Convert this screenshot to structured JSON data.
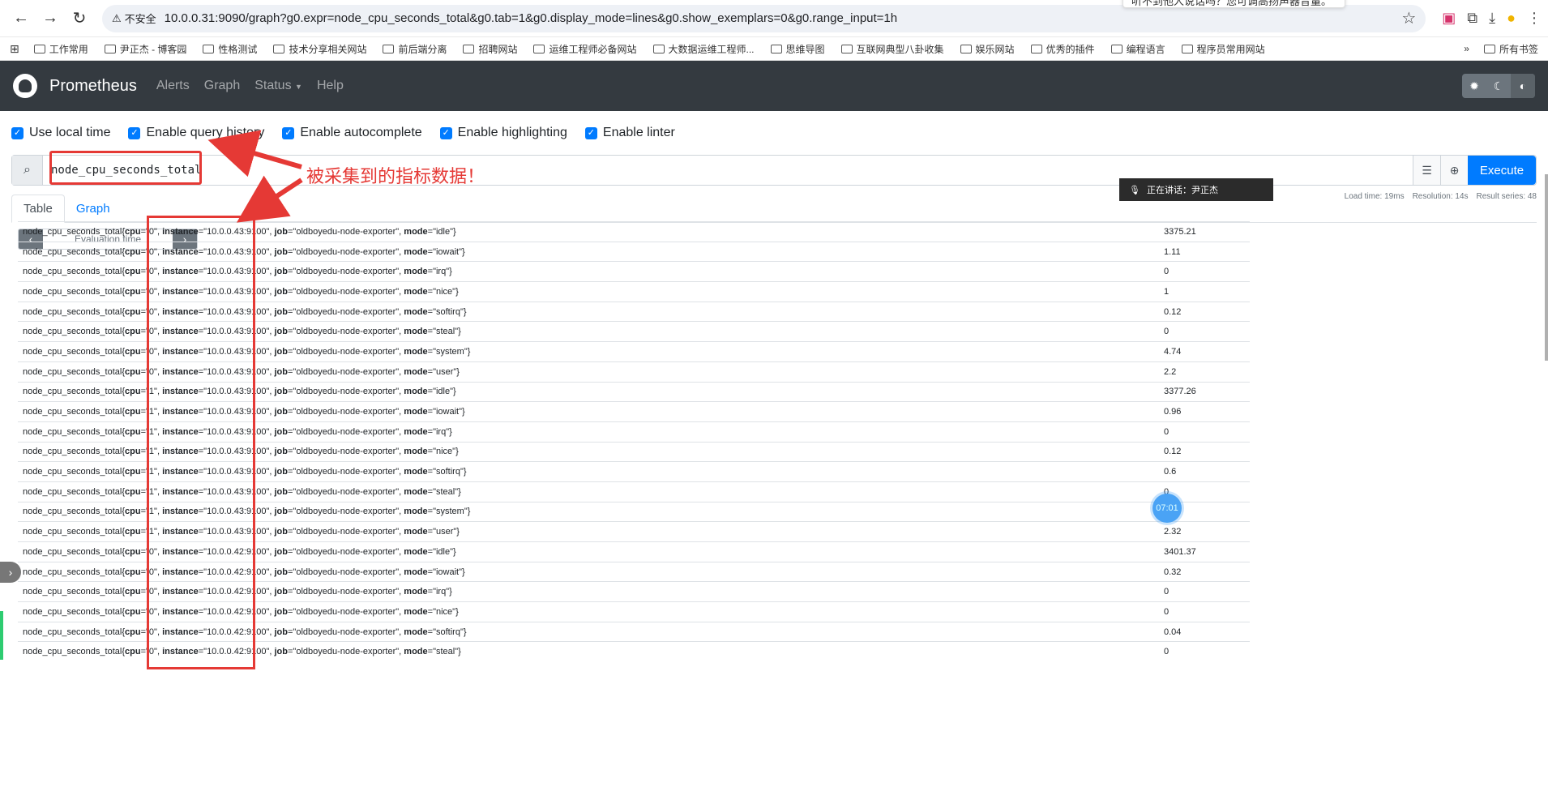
{
  "browser": {
    "insecure_label": "不安全",
    "url": "10.0.0.31:9090/graph?g0.expr=node_cpu_seconds_total&g0.tab=1&g0.display_mode=lines&g0.show_exemplars=0&g0.range_input=1h",
    "popup_text": "听不到他人说话吗？您可调高扬声器音量。",
    "bookmarks": [
      "工作常用",
      "尹正杰 - 博客园",
      "性格测试",
      "技术分享相关网站",
      "前后端分离",
      "招聘网站",
      "运维工程师必备网站",
      "大数据运维工程师...",
      "思维导图",
      "互联网典型八卦收集",
      "娱乐网站",
      "优秀的插件",
      "编程语言",
      "程序员常用网站"
    ],
    "bookmarks_more": "»",
    "bookmarks_all": "所有书签"
  },
  "navbar": {
    "brand": "Prometheus",
    "links": [
      "Alerts",
      "Graph",
      "Status",
      "Help"
    ]
  },
  "options": [
    "Use local time",
    "Enable query history",
    "Enable autocomplete",
    "Enable highlighting",
    "Enable linter"
  ],
  "query": {
    "expr": "node_cpu_seconds_total",
    "execute_label": "Execute"
  },
  "tabs": [
    "Table",
    "Graph"
  ],
  "stats": {
    "load_time": "Load time: 19ms",
    "resolution": "Resolution: 14s",
    "result_series": "Result series: 48"
  },
  "annotation": "被采集到的指标数据！",
  "eval_placeholder": "Evaluation time",
  "overlay": {
    "talking": "正在讲话：尹正杰",
    "timer": "07:01"
  },
  "rows": [
    {
      "metric": "node_cpu_seconds_total",
      "cpu": "0",
      "instance": "10.0.0.43:9100",
      "job": "oldboyedu-node-exporter",
      "mode": "idle",
      "value": "3375.21"
    },
    {
      "metric": "node_cpu_seconds_total",
      "cpu": "0",
      "instance": "10.0.0.43:9100",
      "job": "oldboyedu-node-exporter",
      "mode": "iowait",
      "value": "1.11"
    },
    {
      "metric": "node_cpu_seconds_total",
      "cpu": "0",
      "instance": "10.0.0.43:9100",
      "job": "oldboyedu-node-exporter",
      "mode": "irq",
      "value": "0"
    },
    {
      "metric": "node_cpu_seconds_total",
      "cpu": "0",
      "instance": "10.0.0.43:9100",
      "job": "oldboyedu-node-exporter",
      "mode": "nice",
      "value": "1"
    },
    {
      "metric": "node_cpu_seconds_total",
      "cpu": "0",
      "instance": "10.0.0.43:9100",
      "job": "oldboyedu-node-exporter",
      "mode": "softirq",
      "value": "0.12"
    },
    {
      "metric": "node_cpu_seconds_total",
      "cpu": "0",
      "instance": "10.0.0.43:9100",
      "job": "oldboyedu-node-exporter",
      "mode": "steal",
      "value": "0"
    },
    {
      "metric": "node_cpu_seconds_total",
      "cpu": "0",
      "instance": "10.0.0.43:9100",
      "job": "oldboyedu-node-exporter",
      "mode": "system",
      "value": "4.74"
    },
    {
      "metric": "node_cpu_seconds_total",
      "cpu": "0",
      "instance": "10.0.0.43:9100",
      "job": "oldboyedu-node-exporter",
      "mode": "user",
      "value": "2.2"
    },
    {
      "metric": "node_cpu_seconds_total",
      "cpu": "1",
      "instance": "10.0.0.43:9100",
      "job": "oldboyedu-node-exporter",
      "mode": "idle",
      "value": "3377.26"
    },
    {
      "metric": "node_cpu_seconds_total",
      "cpu": "1",
      "instance": "10.0.0.43:9100",
      "job": "oldboyedu-node-exporter",
      "mode": "iowait",
      "value": "0.96"
    },
    {
      "metric": "node_cpu_seconds_total",
      "cpu": "1",
      "instance": "10.0.0.43:9100",
      "job": "oldboyedu-node-exporter",
      "mode": "irq",
      "value": "0"
    },
    {
      "metric": "node_cpu_seconds_total",
      "cpu": "1",
      "instance": "10.0.0.43:9100",
      "job": "oldboyedu-node-exporter",
      "mode": "nice",
      "value": "0.12"
    },
    {
      "metric": "node_cpu_seconds_total",
      "cpu": "1",
      "instance": "10.0.0.43:9100",
      "job": "oldboyedu-node-exporter",
      "mode": "softirq",
      "value": "0.6"
    },
    {
      "metric": "node_cpu_seconds_total",
      "cpu": "1",
      "instance": "10.0.0.43:9100",
      "job": "oldboyedu-node-exporter",
      "mode": "steal",
      "value": "0"
    },
    {
      "metric": "node_cpu_seconds_total",
      "cpu": "1",
      "instance": "10.0.0.43:9100",
      "job": "oldboyedu-node-exporter",
      "mode": "system",
      "value": ""
    },
    {
      "metric": "node_cpu_seconds_total",
      "cpu": "1",
      "instance": "10.0.0.43:9100",
      "job": "oldboyedu-node-exporter",
      "mode": "user",
      "value": "2.32"
    },
    {
      "metric": "node_cpu_seconds_total",
      "cpu": "0",
      "instance": "10.0.0.42:9100",
      "job": "oldboyedu-node-exporter",
      "mode": "idle",
      "value": "3401.37"
    },
    {
      "metric": "node_cpu_seconds_total",
      "cpu": "0",
      "instance": "10.0.0.42:9100",
      "job": "oldboyedu-node-exporter",
      "mode": "iowait",
      "value": "0.32"
    },
    {
      "metric": "node_cpu_seconds_total",
      "cpu": "0",
      "instance": "10.0.0.42:9100",
      "job": "oldboyedu-node-exporter",
      "mode": "irq",
      "value": "0"
    },
    {
      "metric": "node_cpu_seconds_total",
      "cpu": "0",
      "instance": "10.0.0.42:9100",
      "job": "oldboyedu-node-exporter",
      "mode": "nice",
      "value": "0"
    },
    {
      "metric": "node_cpu_seconds_total",
      "cpu": "0",
      "instance": "10.0.0.42:9100",
      "job": "oldboyedu-node-exporter",
      "mode": "softirq",
      "value": "0.04"
    },
    {
      "metric": "node_cpu_seconds_total",
      "cpu": "0",
      "instance": "10.0.0.42:9100",
      "job": "oldboyedu-node-exporter",
      "mode": "steal",
      "value": "0"
    }
  ]
}
